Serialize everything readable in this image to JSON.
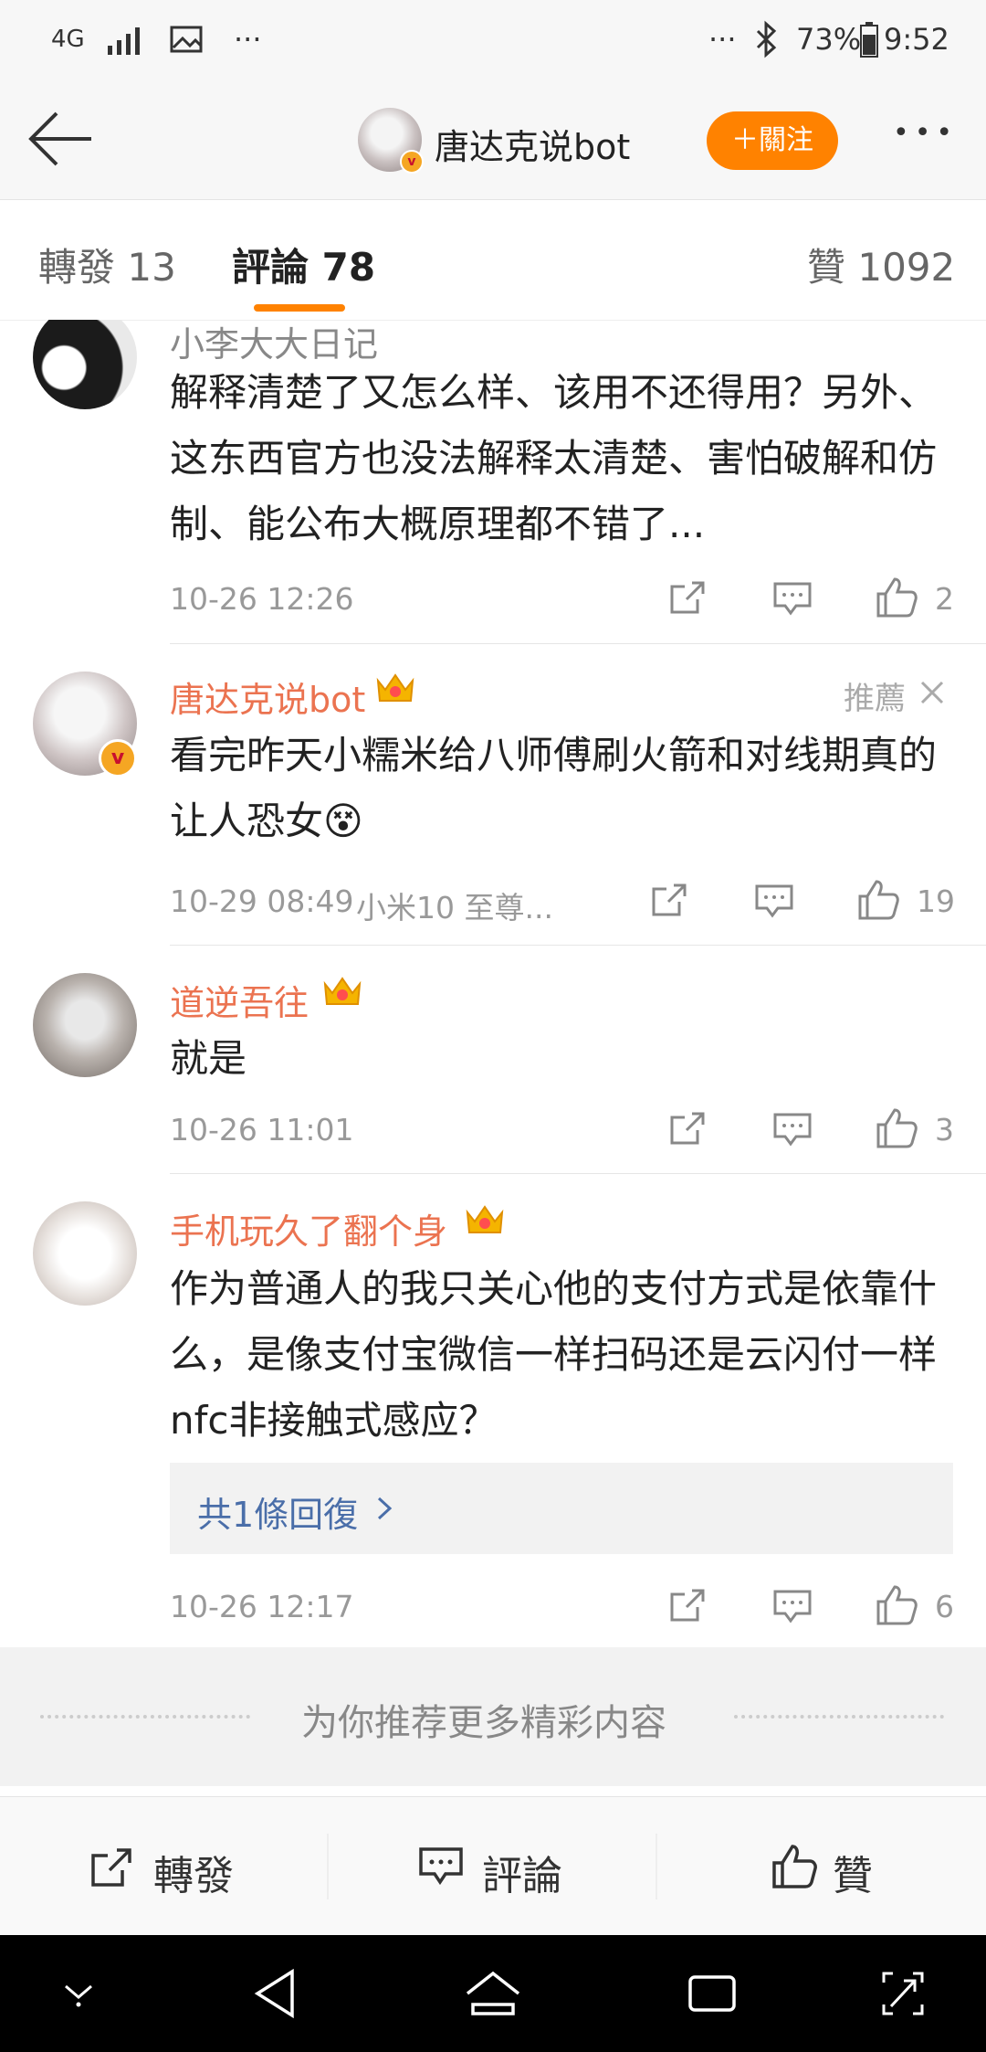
{
  "status_bar": {
    "network": "4G",
    "more": "···",
    "more_right": "···",
    "battery": "73%",
    "time": "9:52"
  },
  "header": {
    "title": "唐达克说bot",
    "follow_label": "＋關注",
    "more_label": "•••"
  },
  "tabs": [
    {
      "label": "轉發 13",
      "active": false
    },
    {
      "label": "評論 78",
      "active": true
    },
    {
      "label": "贊 1092",
      "active": false
    }
  ],
  "comments": [
    {
      "username": "小李大大日记",
      "text": "解释清楚了又怎么样、该用不还得用？另外、这东西官方也没法解释太清楚、害怕破解和仿制、能公布大概原理都不错了...",
      "time": "10-26 12:26",
      "likes": "2"
    },
    {
      "username": "唐达克说bot",
      "pinned_label": "推薦",
      "text": "看完昨天小糯米给八师傅刷火箭和对线期真的让人恐女😵",
      "time": "10-29 08:49",
      "device": "小米10 至尊...",
      "likes": "19"
    },
    {
      "username": "道逆吾往",
      "text": "就是",
      "time": "10-26 11:01",
      "likes": "3"
    },
    {
      "username": "手机玩久了翻个身",
      "text": "作为普通人的我只关心他的支付方式是依靠什么，是像支付宝微信一样扫码还是云闪付一样nfc非接触式感应？",
      "reply_summary": "共1條回復",
      "time": "10-26 12:17",
      "likes": "6"
    }
  ],
  "recommend_label": "为你推荐更多精彩内容",
  "bottom_bar": {
    "repost_label": "轉發",
    "comment_label": "評論",
    "like_label": "贊"
  },
  "colors": {
    "accent": "#ff8200",
    "username": "#eb7350",
    "link": "#4a6ea9"
  }
}
